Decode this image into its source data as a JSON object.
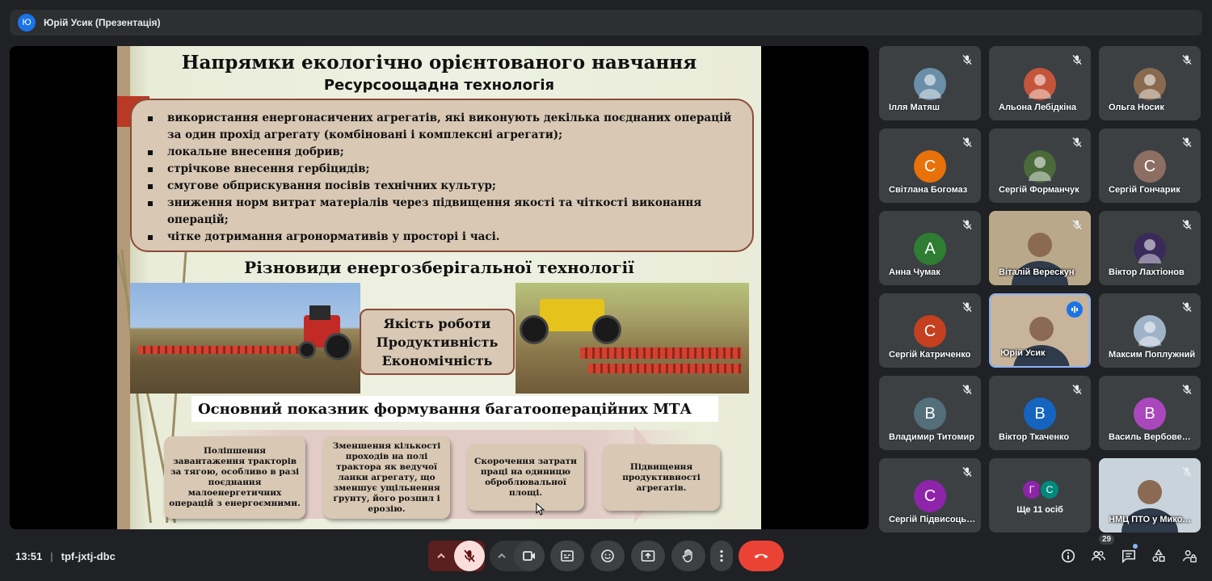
{
  "presenter": {
    "avatar_letter": "Ю",
    "label": "Юрій Усик (Презентація)"
  },
  "slide": {
    "title": "Напрямки екологічно орієнтованого навчання",
    "subtitle": "Ресурсоощадна технологія",
    "bullets": [
      "використання енергонасичених агрегатів, які виконують декілька поєднаних операцій за один прохід агрегату (комбіновані і комплексні агрегати);",
      "локальне внесення добрив;",
      "стрічкове внесення гербіцидів;",
      "смугове обприскування посівів технічних культур;",
      "зниження норм витрат матеріалів через підвищення якості та чіткості виконання операцій;",
      "чітке дотримання агронормативів у просторі і часі."
    ],
    "section_title": "Різновиди енергозберігальної технології",
    "quality_lines": [
      "Якість роботи",
      "Продуктивність",
      "Економічність"
    ],
    "main_indicator": "Основний показник формування багатоопераційних МТА",
    "cards": [
      "Поліпшення завантаження тракторів за тягою, особливо в разі поєднання малоенергетичних операцій з енергоємними.",
      "Зменшення кількості проходів на полі трактора як ведучої ланки агрегату, що зменшує ущільнення ґрунту, його розпил і ерозію.",
      "Скорочення затрати праці на одиницю оброблювальної площі.",
      "Підвищення продуктивності агрегатів."
    ]
  },
  "participants": [
    {
      "name": "Ілля Матяш",
      "type": "photo",
      "color": "#6b8fa8"
    },
    {
      "name": "Альона Лебідкіна",
      "type": "photo",
      "color": "#c4553a"
    },
    {
      "name": "Ольга Носик",
      "type": "photo",
      "color": "#8a6a4e"
    },
    {
      "name": "Світлана Богомаз",
      "type": "letter",
      "letter": "С",
      "color": "#e8710a"
    },
    {
      "name": "Сергій Форманчук",
      "type": "photo",
      "color": "#4a6a3a"
    },
    {
      "name": "Сергій Гончарик",
      "type": "letter",
      "letter": "С",
      "color": "#8d6e63"
    },
    {
      "name": "Анна Чумак",
      "type": "letter",
      "letter": "А",
      "color": "#2e7d32"
    },
    {
      "name": "Віталій Верескун",
      "type": "video",
      "color": "#b9a88a"
    },
    {
      "name": "Віктор Лахтіонов",
      "type": "photo",
      "color": "#3a2a5a"
    },
    {
      "name": "Сергій Катриченко",
      "type": "letter",
      "letter": "С",
      "color": "#c5401f"
    },
    {
      "name": "Юрій Усик",
      "type": "video",
      "color": "#c7b49a"
    },
    {
      "name": "Максим Поплужний",
      "type": "photo",
      "color": "#9fb3c8"
    },
    {
      "name": "Владимир Титомир",
      "type": "letter",
      "letter": "В",
      "color": "#546e7a"
    },
    {
      "name": "Віктор Ткаченко",
      "type": "letter",
      "letter": "В",
      "color": "#1565c0"
    },
    {
      "name": "Василь Вербовенко",
      "type": "letter",
      "letter": "В",
      "color": "#ab47bc"
    },
    {
      "name": "Сергій Підвисоцький",
      "type": "letter",
      "letter": "С",
      "color": "#8e24aa"
    },
    {
      "name": "Ще 11 осіб",
      "type": "more",
      "letters": [
        "Г",
        "С"
      ],
      "colors": [
        "#8e24aa",
        "#00897b"
      ]
    },
    {
      "name": "НМЦ ПТО у Миколаївській",
      "type": "video",
      "color": "#c9d3dc"
    }
  ],
  "meeting": {
    "time": "13:51",
    "code": "tpf-jxtj-dbc"
  },
  "people_count": "29"
}
